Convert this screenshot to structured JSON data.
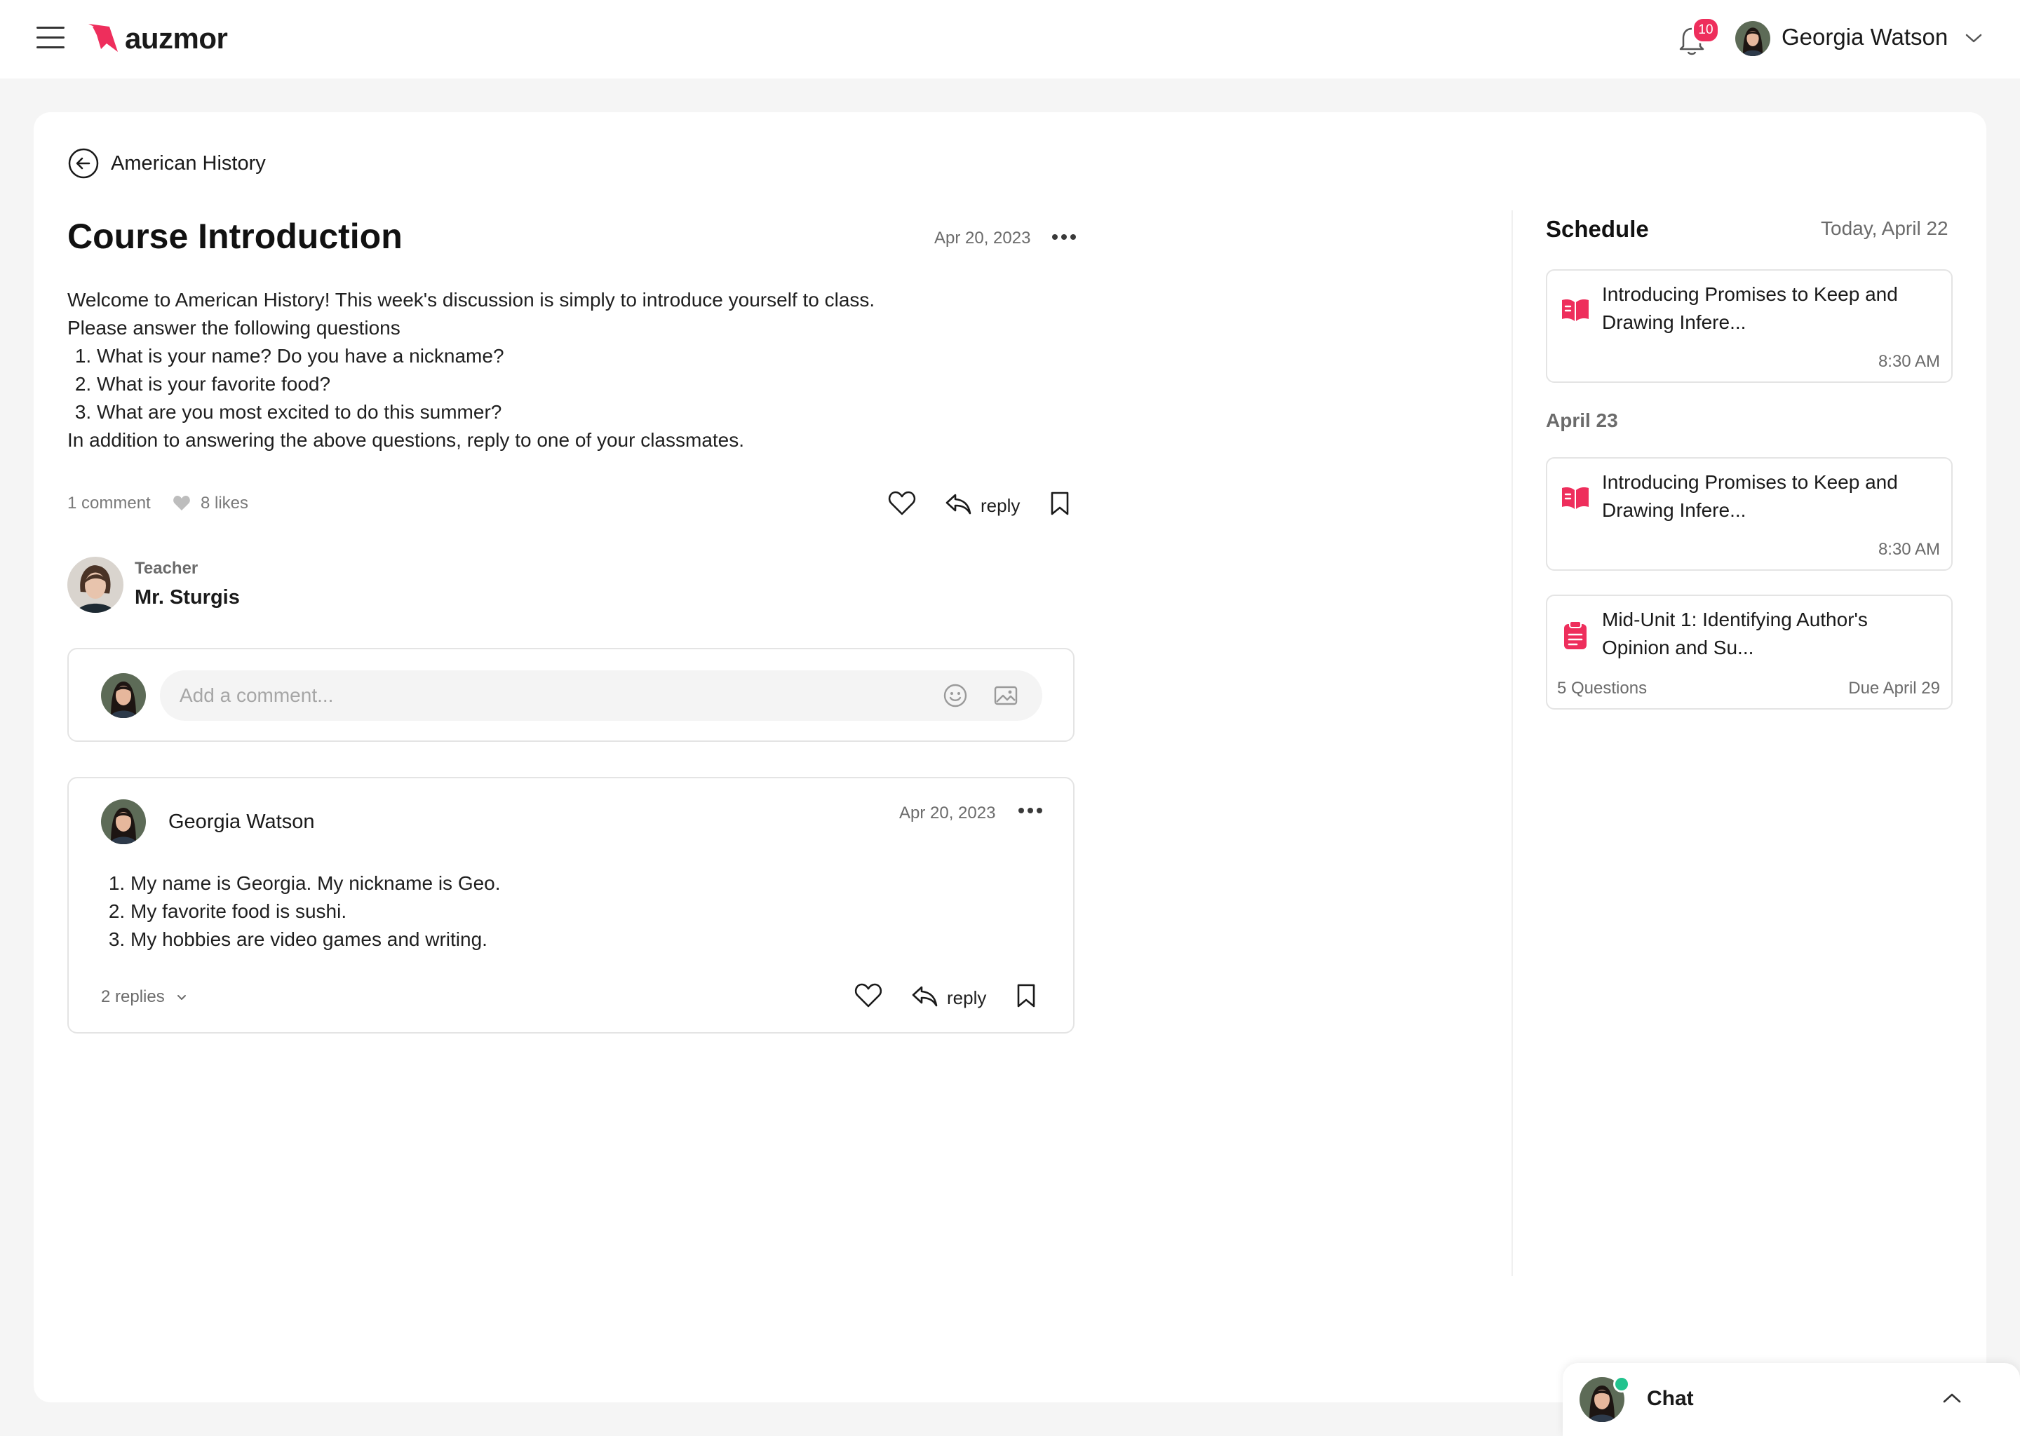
{
  "header": {
    "logo_text": "auzmor",
    "notification_count": "10",
    "user_name": "Georgia Watson"
  },
  "breadcrumb": {
    "back_label": "American History"
  },
  "post": {
    "title": "Course Introduction",
    "date": "Apr 20, 2023",
    "intro": "Welcome to American History! This week's discussion is simply to introduce yourself to class.",
    "instruction": "Please answer the following questions",
    "questions": [
      "What is your name? Do you have a nickname?",
      "What is your favorite food?",
      "What are you most excited to do this summer?"
    ],
    "closing": "In addition to answering the above questions, reply to one of your classmates.",
    "comment_count": "1 comment",
    "likes": "8 likes",
    "reply_label": "reply",
    "author_role": "Teacher",
    "author_name": "Mr. Sturgis"
  },
  "comment_box": {
    "placeholder": "Add a comment..."
  },
  "reply": {
    "author": "Georgia Watson",
    "date": "Apr 20, 2023",
    "items": [
      "My name is Georgia. My nickname is Geo.",
      "My favorite food is sushi.",
      "My hobbies are video games and writing."
    ],
    "replies_count": "2 replies",
    "reply_label": "reply"
  },
  "schedule": {
    "title": "Schedule",
    "today_label": "Today, April 22",
    "day_label": "April 23",
    "items": [
      {
        "title": "Introducing Promises to Keep and Drawing Infere...",
        "time": "8:30 AM",
        "icon": "book-icon"
      },
      {
        "title": "Introducing Promises to Keep and Drawing Infere...",
        "time": "8:30 AM",
        "icon": "book-icon"
      },
      {
        "title": "Mid-Unit 1: Identifying Author's Opinion and Su...",
        "questions": "5 Questions",
        "due": "Due April 29",
        "icon": "clipboard-icon"
      }
    ]
  },
  "chat": {
    "label": "Chat",
    "status": "online"
  },
  "colors": {
    "accent": "#EE2E5C",
    "online": "#22C38E",
    "text": "#141414",
    "muted": "#6B6B6B"
  }
}
